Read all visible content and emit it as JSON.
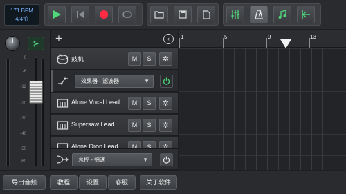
{
  "transport": {
    "bpm": "171 BPM",
    "time_signature": "4/4拍"
  },
  "tracks": [
    {
      "name": "鼓机",
      "mute": "M",
      "solo": "S"
    },
    {
      "name": "Alone Vocal Lead",
      "mute": "M",
      "solo": "S"
    },
    {
      "name": "Supersaw Lead",
      "mute": "M",
      "solo": "S"
    },
    {
      "name": "Alone Drop Lead",
      "mute": "M",
      "solo": "S"
    }
  ],
  "effect_row": {
    "selector": "效果器 - 滤波器"
  },
  "master_row": {
    "selector": "总控 - 拍速"
  },
  "timeline": {
    "markers": [
      "1",
      "5",
      "9",
      "13"
    ]
  },
  "mixer": {
    "scale": [
      "0",
      "-6",
      "-12",
      "-20",
      "-30",
      "-40",
      "-50",
      "-60"
    ]
  },
  "bottom": {
    "export": "导出音频",
    "tutorial": "教程",
    "settings": "设置",
    "support": "客服",
    "about": "关于软件"
  },
  "colors": {
    "accent_green": "#4fd67a",
    "record_red": "#ff2b45",
    "bpm_blue": "#7fb6ff"
  }
}
